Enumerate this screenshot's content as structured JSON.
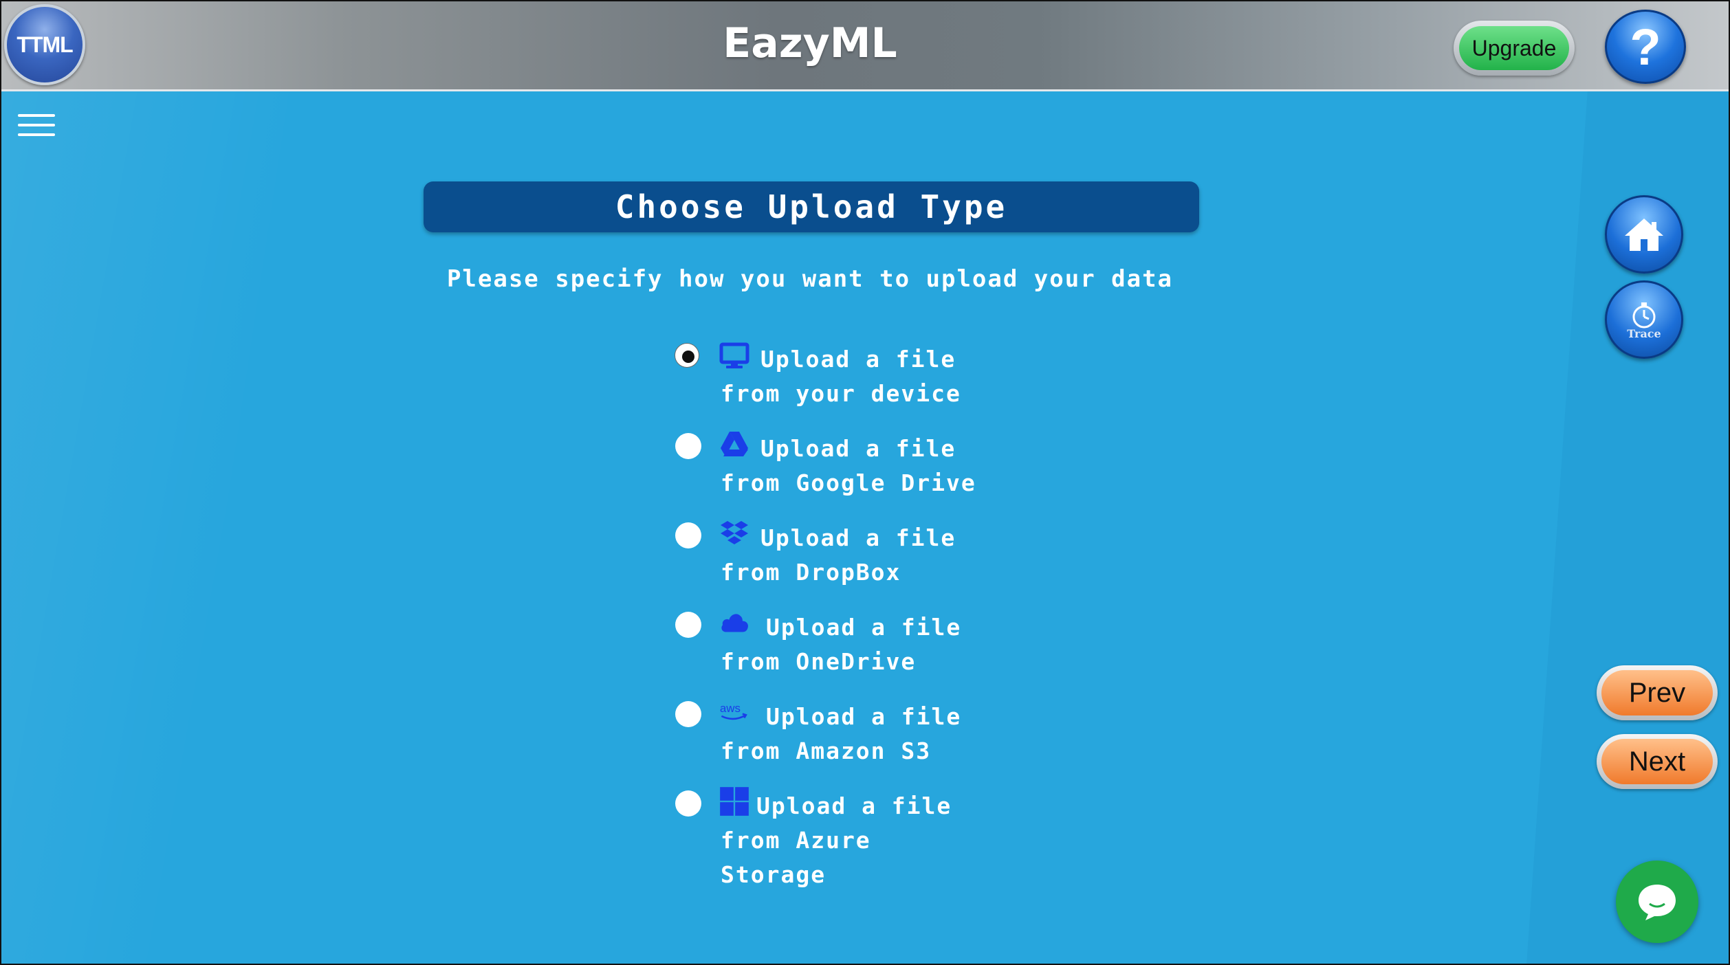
{
  "header": {
    "logo_text": "TTML",
    "title": "EazyML",
    "upgrade_label": "Upgrade",
    "help_label": "?"
  },
  "panel": {
    "title": "Choose Upload Type",
    "subtitle": "Please specify how you want to upload your data"
  },
  "options": [
    {
      "label": "Upload a file\nfrom your device",
      "icon": "monitor-icon",
      "selected": true
    },
    {
      "label": "Upload a file\nfrom Google Drive",
      "icon": "google-drive-icon",
      "selected": false
    },
    {
      "label": "Upload a file\nfrom DropBox",
      "icon": "dropbox-icon",
      "selected": false
    },
    {
      "label": "Upload a file\nfrom OneDrive",
      "icon": "cloud-icon",
      "selected": false
    },
    {
      "label": "Upload a file\nfrom Amazon S3",
      "icon": "aws-icon",
      "selected": false
    },
    {
      "label": "Upload a file\nfrom Azure\nStorage",
      "icon": "windows-icon",
      "selected": false
    }
  ],
  "side": {
    "trace_label": "Trace",
    "prev_label": "Prev",
    "next_label": "Next"
  },
  "colors": {
    "background": "#27a6dd",
    "title_bar": "#0a4e8e",
    "icon_blue": "#1a3ee8",
    "chat_green": "#1faa4a"
  }
}
